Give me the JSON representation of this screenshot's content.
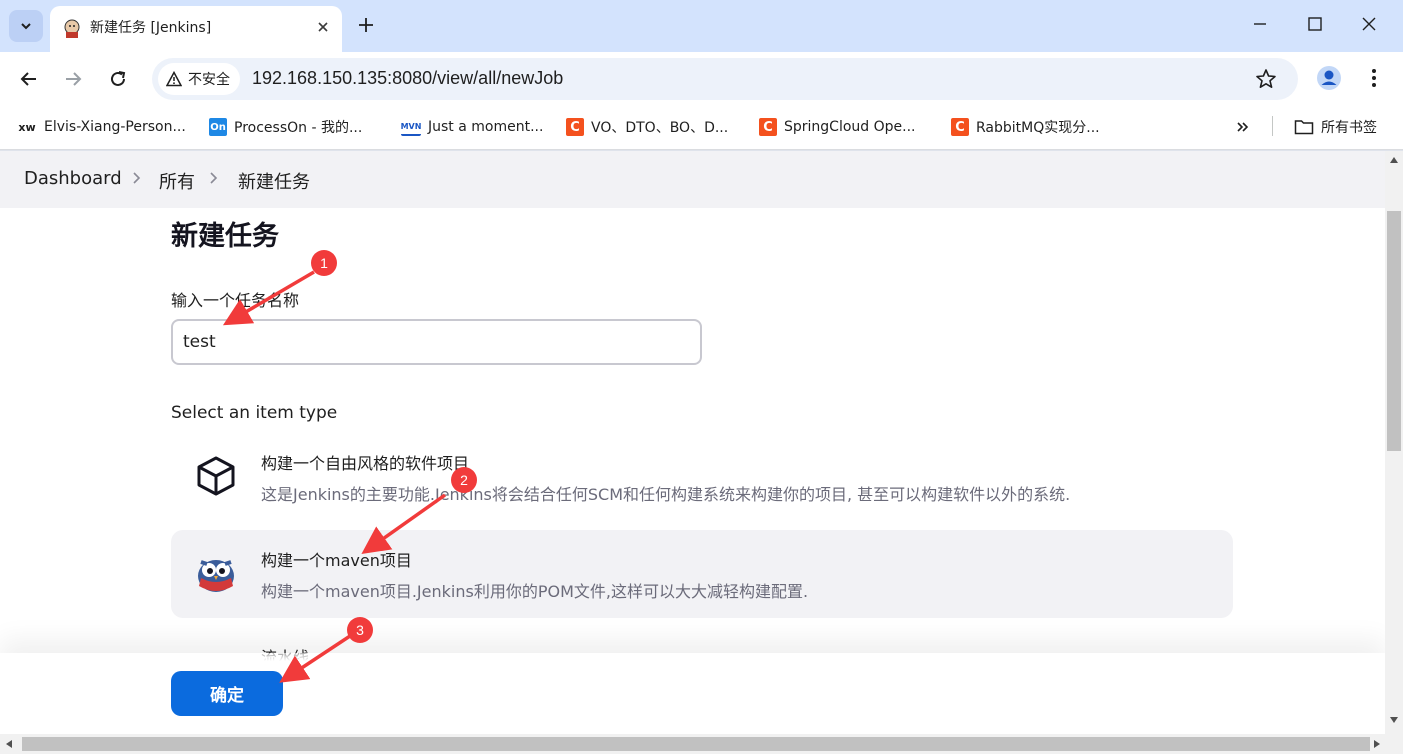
{
  "browser": {
    "tab": {
      "title": "新建任务 [Jenkins]"
    },
    "address": {
      "security_label": "不安全",
      "url": "192.168.150.135:8080/view/all/newJob"
    },
    "bookmarks": [
      {
        "icon_text": "xw",
        "label": "Elvis-Xiang-Person...",
        "color": "#ffffff"
      },
      {
        "icon_text": "On",
        "label": "ProcessOn - 我的...",
        "color": "#1e88e5"
      },
      {
        "icon_text": "MVN",
        "label": "Just a moment...",
        "color": "#ffffff"
      },
      {
        "icon_text": "C",
        "label": "VO、DTO、BO、D...",
        "color": "#f4511e"
      },
      {
        "icon_text": "C",
        "label": "SpringCloud Ope...",
        "color": "#f4511e"
      },
      {
        "icon_text": "C",
        "label": "RabbitMQ实现分...",
        "color": "#f4511e"
      }
    ],
    "all_bookmarks_label": "所有书签"
  },
  "breadcrumb": {
    "dashboard": "Dashboard",
    "all": "所有",
    "current": "新建任务"
  },
  "page": {
    "title": "新建任务",
    "name_label": "输入一个任务名称",
    "name_value": "test",
    "type_label": "Select an item type",
    "items": [
      {
        "title": "构建一个自由风格的软件项目",
        "desc": "这是Jenkins的主要功能.Jenkins将会结合任何SCM和任何构建系统来构建你的项目, 甚至可以构建软件以外的系统."
      },
      {
        "title": "构建一个maven项目",
        "desc": "构建一个maven项目.Jenkins利用你的POM文件,这样可以大大减轻构建配置."
      },
      {
        "title": "流水线",
        "desc": ""
      }
    ],
    "ok_label": "确定"
  },
  "annotations": [
    {
      "number": "1"
    },
    {
      "number": "2"
    },
    {
      "number": "3"
    }
  ],
  "colors": {
    "primary_button": "#0b6bde",
    "annotation": "#f13b3b",
    "tabstrip": "#d3e3fd"
  }
}
